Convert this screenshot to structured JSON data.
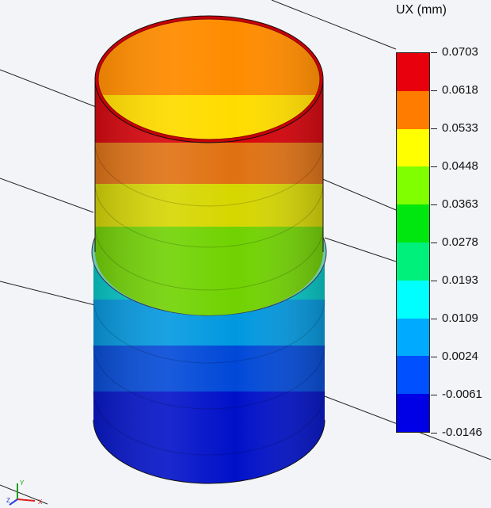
{
  "legend": {
    "title": "UX (mm)",
    "ticks": [
      "0.0703",
      "0.0618",
      "0.0533",
      "0.0448",
      "0.0363",
      "0.0278",
      "0.0193",
      "0.0109",
      "0.0024",
      "-0.0061",
      "-0.0146"
    ],
    "band_colors": [
      "#e8000c",
      "#ff7c00",
      "#ffff00",
      "#80ff00",
      "#00e60f",
      "#00f07c",
      "#00ffff",
      "#00aaff",
      "#0050ff",
      "#0000e6"
    ]
  },
  "model": {
    "top_band_colors": [
      "#d80008",
      "#e07010",
      "#d6d600",
      "#70d200"
    ],
    "bottom_band_colors": [
      "#00c8c8",
      "#0098e0",
      "#0048d8",
      "#0010c8"
    ],
    "inner_colors": [
      "#ff8c00",
      "#ffdc00"
    ]
  },
  "triad": {
    "axis_labels": [
      "Y",
      "X",
      "Z"
    ],
    "axis_colors": [
      "#16a016",
      "#e02020",
      "#2040e0"
    ]
  }
}
